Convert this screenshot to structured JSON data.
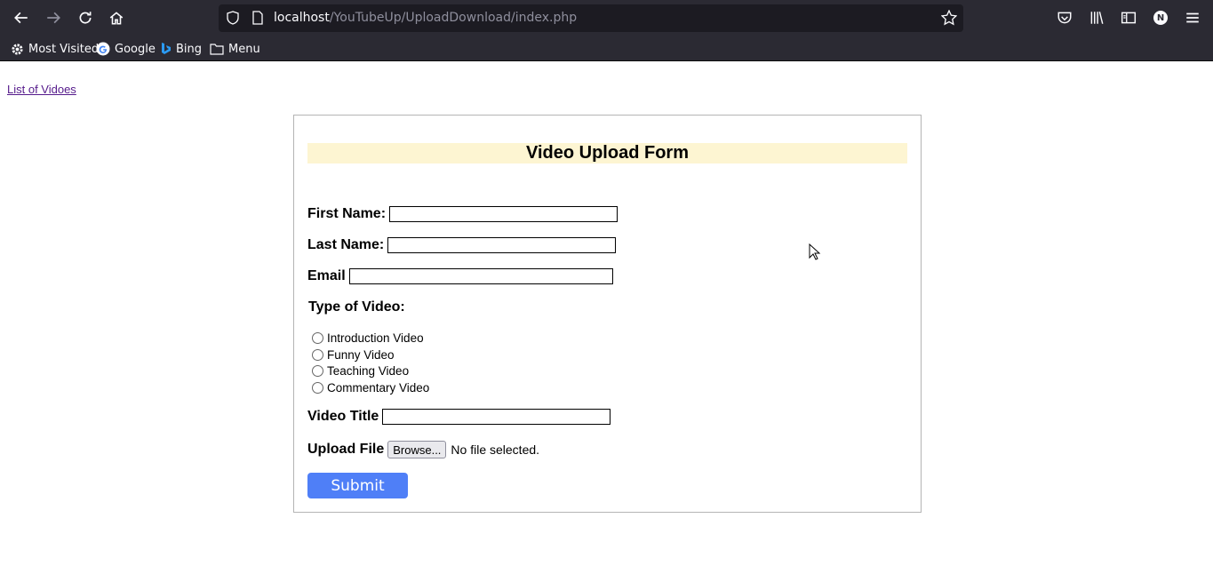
{
  "browser": {
    "url_host": "localhost",
    "url_path": "/YouTubeUp/UploadDownload/index.php",
    "bookmarks": [
      "Most Visited",
      "Google",
      "Bing",
      "Menu"
    ],
    "profile_initial": "N"
  },
  "page": {
    "list_link": "List of Vidoes",
    "form": {
      "title": "Video Upload Form",
      "first_name_label": "First Name:",
      "last_name_label": "Last Name:",
      "email_label": "Email",
      "type_label": "Type of Video:",
      "types": [
        "Introduction Video",
        "Funny Video",
        "Teaching Video",
        "Commentary Video"
      ],
      "video_title_label": "Video Title",
      "upload_label": "Upload File",
      "browse_label": "Browse...",
      "no_file_text": "No file selected.",
      "submit_label": "Submit"
    }
  }
}
